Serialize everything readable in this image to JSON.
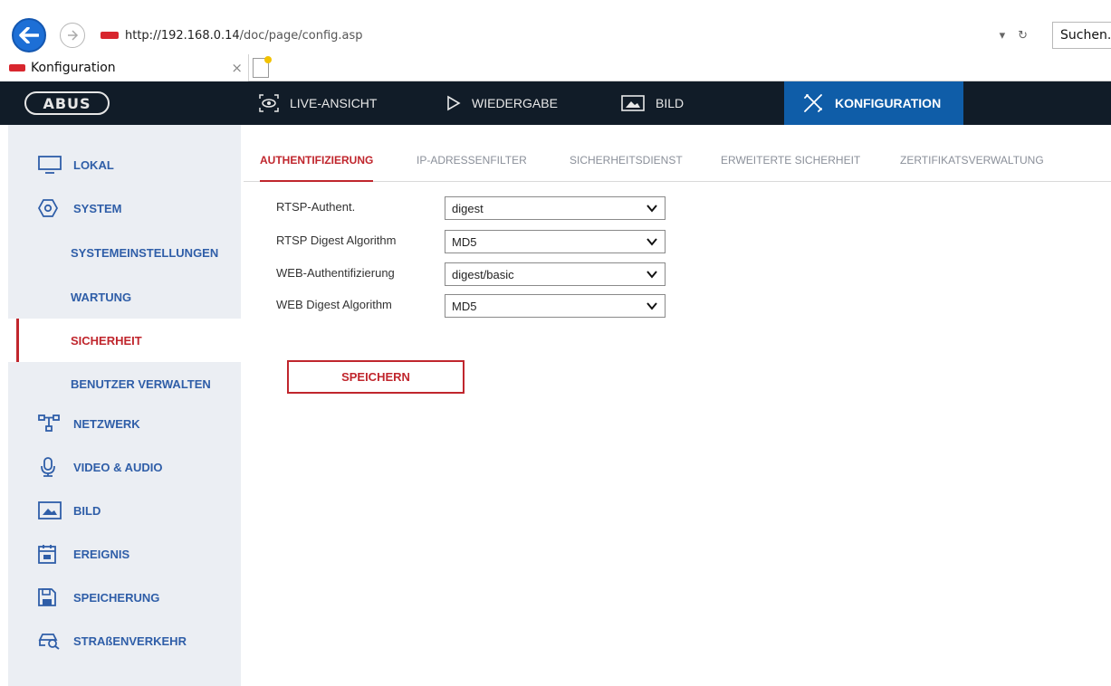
{
  "browser": {
    "url_host": "http://192.168.0.14",
    "url_path": "/doc/page/config.asp",
    "search_placeholder": "Suchen...",
    "tab_title": "Konfiguration",
    "tab_close": "×"
  },
  "topnav": {
    "logo": "ABUS",
    "items": [
      {
        "label": "LIVE-ANSICHT",
        "icon": "eye-icon"
      },
      {
        "label": "WIEDERGABE",
        "icon": "play-icon"
      },
      {
        "label": "BILD",
        "icon": "image-icon"
      },
      {
        "label": "KONFIGURATION",
        "icon": "tools-icon",
        "active": true
      }
    ]
  },
  "sidebar": {
    "items": [
      {
        "label": "LOKAL",
        "icon": "monitor-icon"
      },
      {
        "label": "SYSTEM",
        "icon": "gear-icon"
      },
      {
        "label": "SYSTEMEINSTELLUNGEN"
      },
      {
        "label": "WARTUNG"
      },
      {
        "label": "SICHERHEIT",
        "active": true
      },
      {
        "label": "BENUTZER VERWALTEN"
      },
      {
        "label": "NETZWERK",
        "icon": "network-icon"
      },
      {
        "label": "VIDEO & AUDIO",
        "icon": "microphone-icon"
      },
      {
        "label": "BILD",
        "icon": "image-icon"
      },
      {
        "label": "EREIGNIS",
        "icon": "calendar-icon"
      },
      {
        "label": "SPEICHERUNG",
        "icon": "save-icon"
      },
      {
        "label": "STRAßENVERKEHR",
        "icon": "car-search-icon"
      }
    ]
  },
  "subtabs": [
    {
      "label": "AUTHENTIFIZIERUNG",
      "active": true
    },
    {
      "label": "IP-ADRESSENFILTER"
    },
    {
      "label": "SICHERHEITSDIENST"
    },
    {
      "label": "ERWEITERTE SICHERHEIT"
    },
    {
      "label": "ZERTIFIKATSVERWALTUNG"
    }
  ],
  "form": {
    "fields": [
      {
        "label": "RTSP-Authent.",
        "value": "digest"
      },
      {
        "label": "RTSP Digest Algorithm",
        "value": "MD5"
      },
      {
        "label": "WEB-Authentifizierung",
        "value": "digest/basic"
      },
      {
        "label": "WEB Digest Algorithm",
        "value": "MD5"
      }
    ],
    "save_label": "SPEICHERN"
  },
  "colors": {
    "accent_red": "#c0262d",
    "nav_dark": "#111c28",
    "nav_active": "#0f5da8",
    "sidebar_bg": "#ebeef3",
    "link_blue": "#2f5ea8"
  }
}
